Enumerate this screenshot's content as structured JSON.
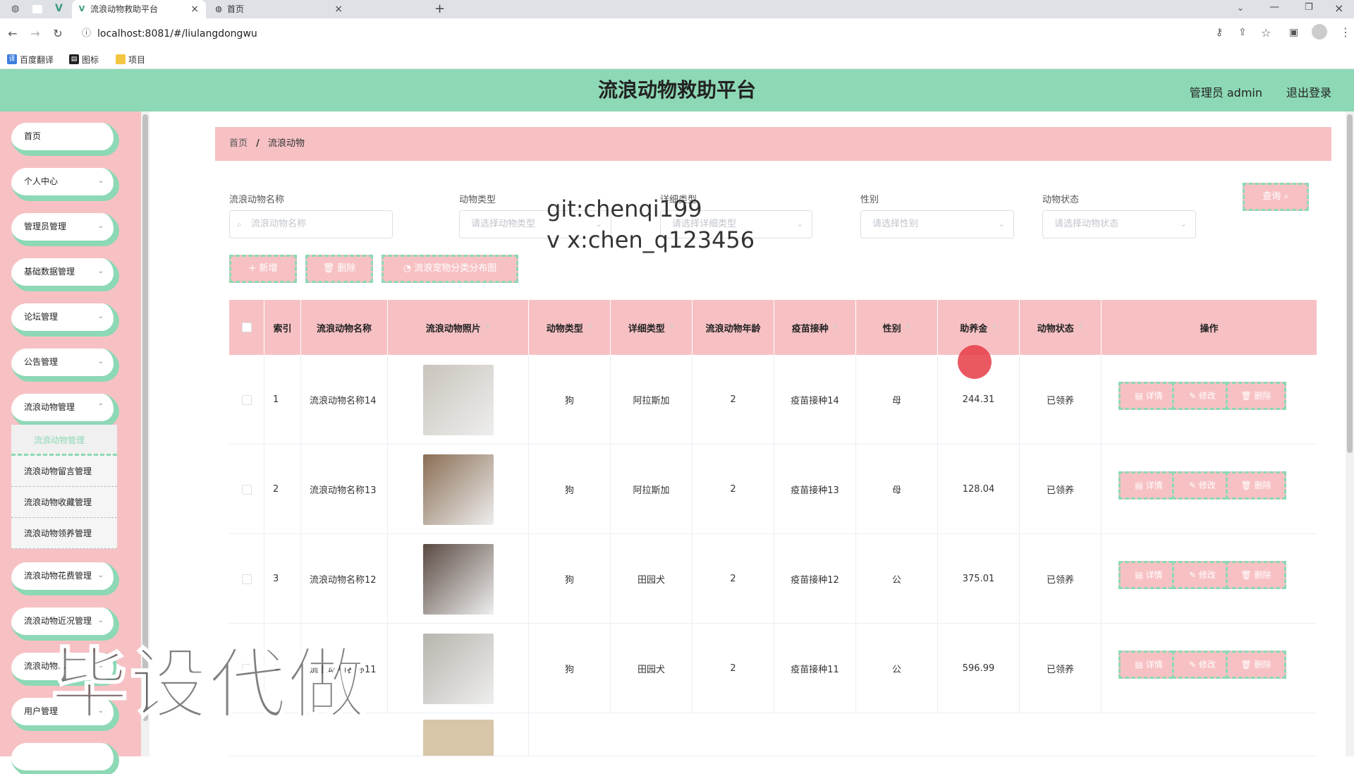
{
  "browser": {
    "tabs": [
      {
        "title": "流浪动物救助平台",
        "icon": "vue-icon"
      },
      {
        "title": "首页",
        "icon": "globe-icon"
      }
    ],
    "url": "localhost:8081/#/liulangdongwu",
    "bookmarks": [
      "百度翻译",
      "图标",
      "项目"
    ]
  },
  "header": {
    "title": "流浪动物救助平台",
    "user": "管理员 admin",
    "logout": "退出登录"
  },
  "sidebar": {
    "items": [
      {
        "label": "首页"
      },
      {
        "label": "个人中心"
      },
      {
        "label": "管理员管理"
      },
      {
        "label": "基础数据管理"
      },
      {
        "label": "论坛管理"
      },
      {
        "label": "公告管理"
      },
      {
        "label": "流浪动物管理"
      }
    ],
    "subitems": [
      "流浪动物管理",
      "流浪动物留言管理",
      "流浪动物收藏管理",
      "流浪动物领养管理"
    ],
    "items_after": [
      {
        "label": "流浪动物花费管理"
      },
      {
        "label": "流浪动物近况管理"
      },
      {
        "label": "流浪动物..."
      },
      {
        "label": "用户管理"
      }
    ]
  },
  "breadcrumb": {
    "home": "首页",
    "sep": "/",
    "current": "流浪动物"
  },
  "filters": {
    "name_label": "流浪动物名称",
    "name_placeholder": "流浪动物名称",
    "type_label": "动物类型",
    "type_placeholder": "请选择动物类型",
    "detail_label": "详细类型",
    "detail_placeholder": "请选择详细类型",
    "sex_label": "性别",
    "sex_placeholder": "请选择性别",
    "status_label": "动物状态",
    "status_placeholder": "请选择动物状态",
    "query": "查询"
  },
  "actions": {
    "add": "+ 新增",
    "delete": "删除",
    "chart": "流浪宠物分类分布图"
  },
  "watermark": {
    "line1": "git:chenqi199",
    "line2": "v x:chen_q123456",
    "big": "毕设代做"
  },
  "table": {
    "headers": [
      "索引",
      "流浪动物名称",
      "流浪动物照片",
      "动物类型",
      "详细类型",
      "流浪动物年龄",
      "疫苗接种",
      "性别",
      "助养金",
      "动物状态",
      "操作"
    ],
    "rows": [
      {
        "idx": "1",
        "name": "流浪动物名称14",
        "type": "狗",
        "detail": "阿拉斯加",
        "age": "2",
        "vaccine": "疫苗接种14",
        "sex": "母",
        "fund": "244.31",
        "status": "已领养",
        "photo": "#c9c4bb"
      },
      {
        "idx": "2",
        "name": "流浪动物名称13",
        "type": "狗",
        "detail": "阿拉斯加",
        "age": "2",
        "vaccine": "疫苗接种13",
        "sex": "母",
        "fund": "128.04",
        "status": "已领养",
        "photo": "#8a6e55"
      },
      {
        "idx": "3",
        "name": "流浪动物名称12",
        "type": "狗",
        "detail": "田园犬",
        "age": "2",
        "vaccine": "疫苗接种12",
        "sex": "公",
        "fund": "375.01",
        "status": "已领养",
        "photo": "#5a4a42"
      },
      {
        "idx": "4",
        "name": "流浪动物名称11",
        "type": "狗",
        "detail": "田园犬",
        "age": "2",
        "vaccine": "疫苗接种11",
        "sex": "公",
        "fund": "596.99",
        "status": "已领养",
        "photo": "#b8b4ad"
      }
    ],
    "row_actions": {
      "detail": "详情",
      "edit": "修改",
      "delete": "删除"
    }
  },
  "colors": {
    "accent": "#8dd8b5",
    "pink": "#f7c1c4"
  }
}
